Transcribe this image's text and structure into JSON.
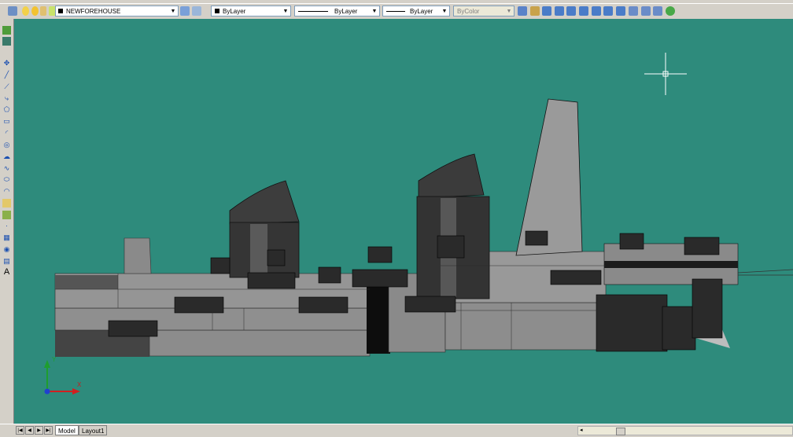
{
  "toolbar": {
    "layer_name": "NEWFOREHOUSE",
    "color": "ByLayer",
    "linetype": "ByLayer",
    "lineweight": "ByLayer",
    "plotstyle": "ByColor"
  },
  "tabs": [
    "Model",
    "Layout1"
  ],
  "ucs": {
    "x_label": "X",
    "y_label": "Y"
  },
  "colors": {
    "viewport": "#2e8b7c",
    "chrome": "#d4d0c8",
    "hull": "#8c8c8c"
  }
}
